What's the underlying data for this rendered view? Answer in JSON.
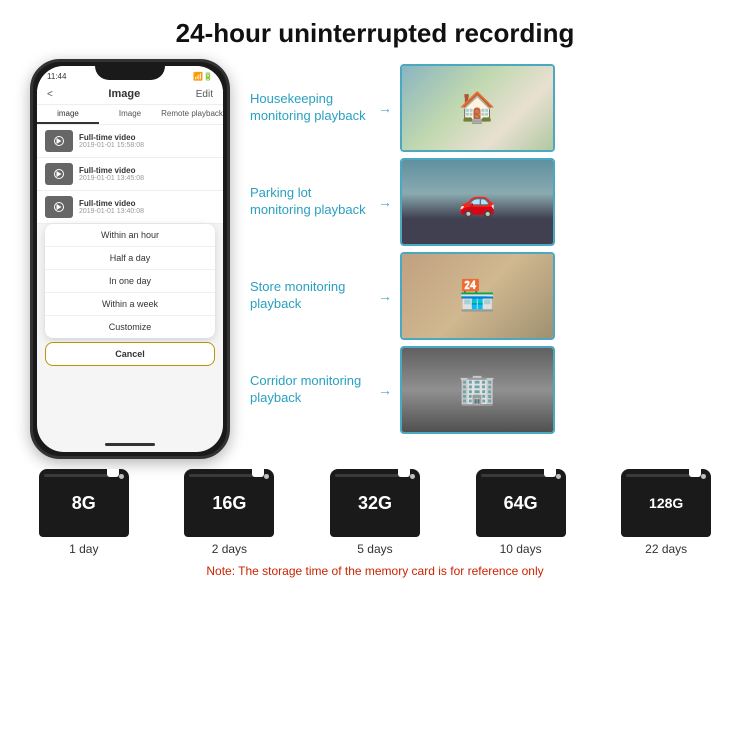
{
  "header": {
    "title": "24-hour uninterrupted recording"
  },
  "phone": {
    "time": "11:44",
    "screen_title": "Image",
    "back_label": "<",
    "edit_label": "Edit",
    "tabs": [
      "image",
      "Image",
      "Remote playback"
    ],
    "list_items": [
      {
        "label": "Full-time video",
        "date": "2019-01-01 15:58:08"
      },
      {
        "label": "Full-time video",
        "date": "2019-01-01 13:45:08"
      },
      {
        "label": "Full-time video",
        "date": "2019-01-01 13:40:08"
      }
    ],
    "dropdown_items": [
      "Within an hour",
      "Half a day",
      "In one day",
      "Within a week",
      "Customize"
    ],
    "cancel_label": "Cancel"
  },
  "monitoring": {
    "items": [
      {
        "label": "Housekeeping monitoring playback",
        "img_type": "housekeeping"
      },
      {
        "label": "Parking lot monitoring playback",
        "img_type": "parking"
      },
      {
        "label": "Store monitoring playback",
        "img_type": "store"
      },
      {
        "label": "Corridor monitoring playback",
        "img_type": "corridor"
      }
    ]
  },
  "storage": {
    "cards": [
      {
        "size": "8G",
        "days": "1 day"
      },
      {
        "size": "16G",
        "days": "2 days"
      },
      {
        "size": "32G",
        "days": "5 days"
      },
      {
        "size": "64G",
        "days": "10 days"
      },
      {
        "size": "128G",
        "days": "22 days"
      }
    ],
    "note": "Note: The storage time of the memory card is for reference only"
  }
}
